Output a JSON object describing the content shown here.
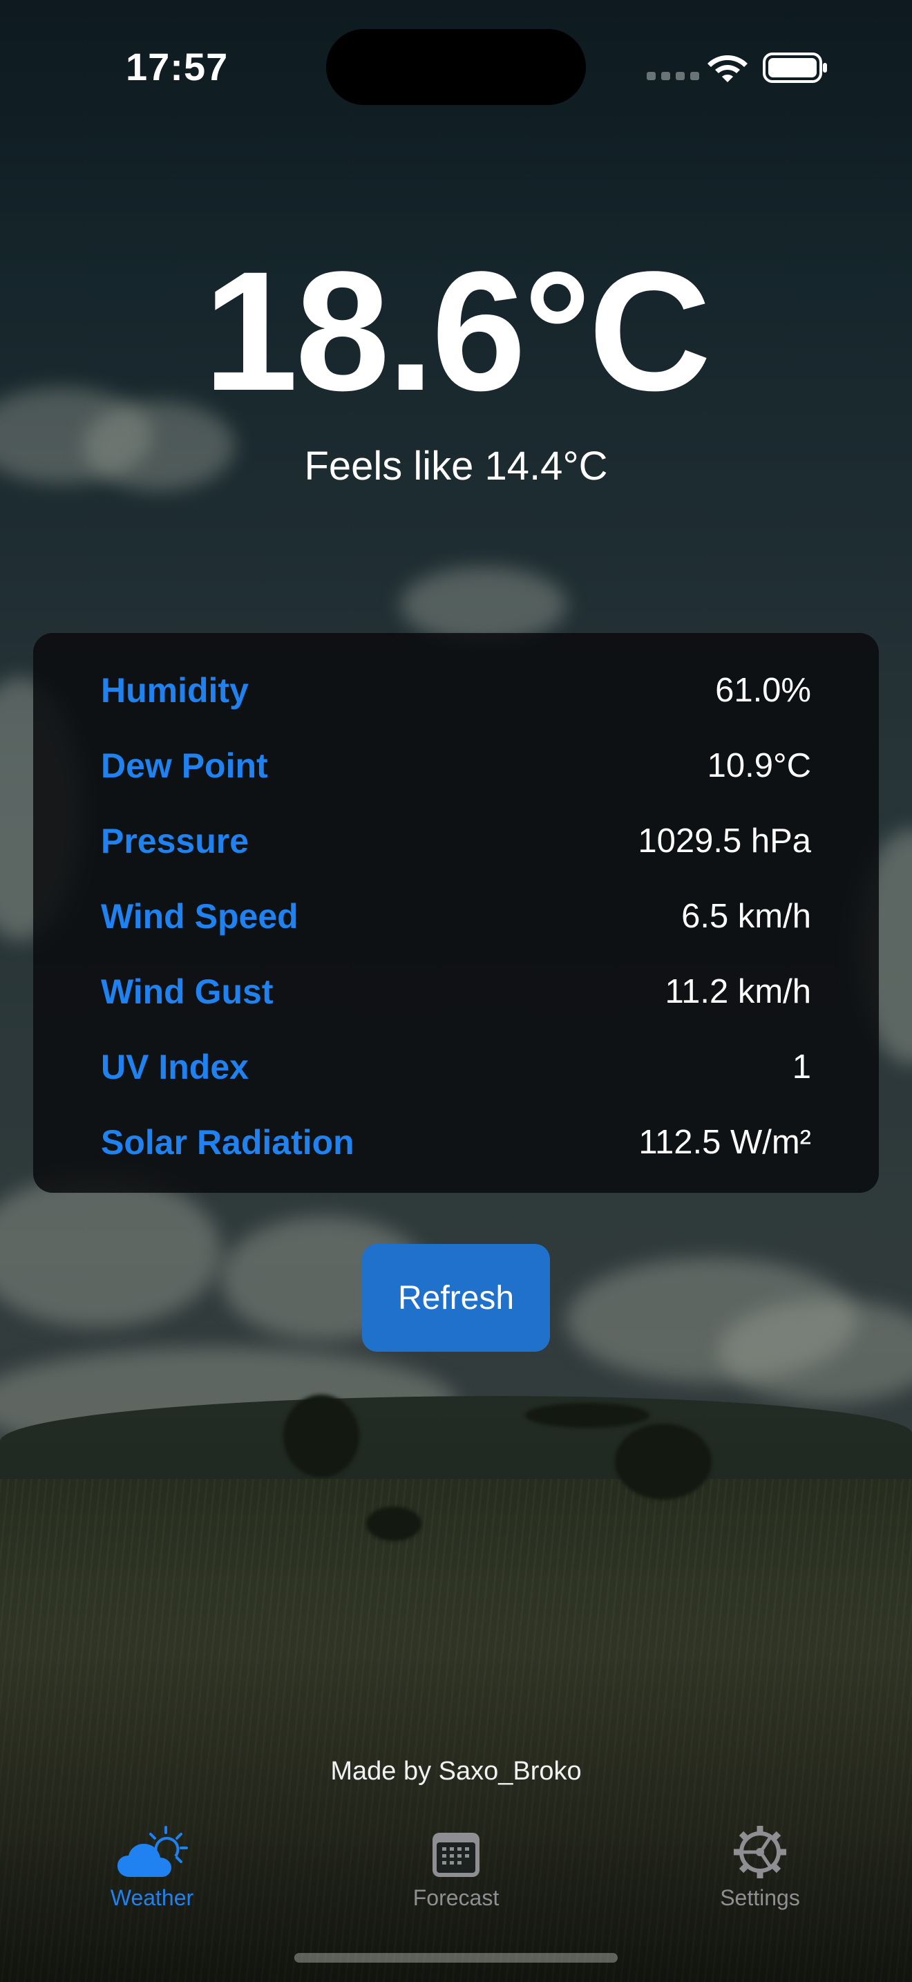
{
  "status_bar": {
    "time": "17:57"
  },
  "current": {
    "temperature": "18.6°C",
    "feels_like": "Feels like 14.4°C"
  },
  "metrics": [
    {
      "label": "Humidity",
      "value": "61.0%"
    },
    {
      "label": "Dew Point",
      "value": "10.9°C"
    },
    {
      "label": "Pressure",
      "value": "1029.5 hPa"
    },
    {
      "label": "Wind Speed",
      "value": "6.5 km/h"
    },
    {
      "label": "Wind Gust",
      "value": "11.2 km/h"
    },
    {
      "label": "UV Index",
      "value": "1"
    },
    {
      "label": "Solar Radiation",
      "value": "112.5 W/m²"
    }
  ],
  "refresh_label": "Refresh",
  "credit": "Made by Saxo_Broko",
  "tabs": [
    {
      "label": "Weather",
      "icon": "cloud-sun-icon",
      "active": true
    },
    {
      "label": "Forecast",
      "icon": "calendar-icon",
      "active": false
    },
    {
      "label": "Settings",
      "icon": "gear-icon",
      "active": false
    }
  ],
  "colors": {
    "accent": "#1f82f0",
    "button": "#2071cc",
    "inactive_tab": "#8e8e93"
  }
}
